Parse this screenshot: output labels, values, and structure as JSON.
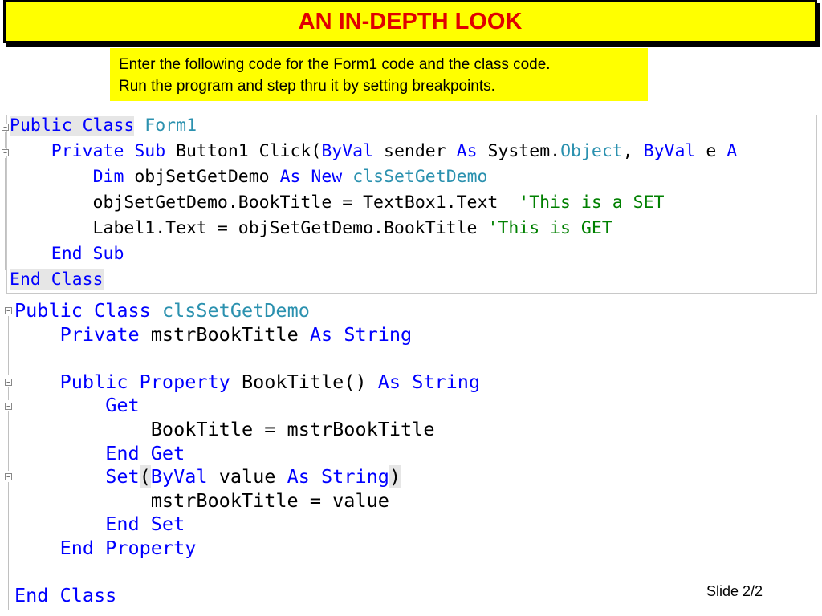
{
  "title": "AN IN-DEPTH LOOK",
  "instructions": [
    "Enter the following code for the Form1 code and the class code.",
    "Run the program and step thru it by setting breakpoints."
  ],
  "form1_code": [
    [
      [
        "Public Class",
        "kw hl"
      ],
      [
        " ",
        ""
      ],
      [
        "Form1",
        "ty"
      ]
    ],
    [
      [
        "    ",
        ""
      ],
      [
        "Private Sub",
        "kw"
      ],
      [
        " Button1_Click(",
        ""
      ],
      [
        "ByVal",
        "kw"
      ],
      [
        " sender ",
        ""
      ],
      [
        "As",
        "kw"
      ],
      [
        " System.",
        ""
      ],
      [
        "Object",
        "ty"
      ],
      [
        ", ",
        ""
      ],
      [
        "ByVal",
        "kw"
      ],
      [
        " e ",
        ""
      ],
      [
        "A",
        "kw"
      ]
    ],
    [
      [
        "        ",
        ""
      ],
      [
        "Dim",
        "kw"
      ],
      [
        " objSetGetDemo ",
        ""
      ],
      [
        "As New",
        "kw"
      ],
      [
        " ",
        ""
      ],
      [
        "clsSetGetDemo",
        "ty"
      ]
    ],
    [
      [
        "        objSetGetDemo.BookTitle = TextBox1.Text  ",
        ""
      ],
      [
        "'This is a SET",
        "cm"
      ]
    ],
    [
      [
        "        Label1.Text = objSetGetDemo.BookTitle ",
        ""
      ],
      [
        "'This is GET",
        "cm"
      ]
    ],
    [
      [
        "    ",
        ""
      ],
      [
        "End Sub",
        "kw"
      ]
    ],
    [
      [
        "End Class",
        "kw hl"
      ]
    ]
  ],
  "class_code": [
    [
      [
        "Public Class",
        "kw"
      ],
      [
        " ",
        ""
      ],
      [
        "clsSetGetDemo",
        "ty"
      ]
    ],
    [
      [
        "    ",
        ""
      ],
      [
        "Private",
        "kw"
      ],
      [
        " mstrBookTitle ",
        ""
      ],
      [
        "As String",
        "kw"
      ]
    ],
    [
      [
        "",
        ""
      ]
    ],
    [
      [
        "    ",
        ""
      ],
      [
        "Public Property",
        "kw"
      ],
      [
        " BookTitle() ",
        ""
      ],
      [
        "As String",
        "kw"
      ]
    ],
    [
      [
        "        ",
        ""
      ],
      [
        "Get",
        "kw"
      ]
    ],
    [
      [
        "            BookTitle = mstrBookTitle",
        ""
      ]
    ],
    [
      [
        "        ",
        ""
      ],
      [
        "End Get",
        "kw"
      ]
    ],
    [
      [
        "        ",
        ""
      ],
      [
        "Set",
        "kw"
      ],
      [
        "(",
        "hl"
      ],
      [
        "ByVal",
        "kw"
      ],
      [
        " value ",
        ""
      ],
      [
        "As String",
        "kw"
      ],
      [
        ")",
        "hl"
      ]
    ],
    [
      [
        "            mstrBookTitle = value",
        ""
      ]
    ],
    [
      [
        "        ",
        ""
      ],
      [
        "End Set",
        "kw"
      ]
    ],
    [
      [
        "    ",
        ""
      ],
      [
        "End Property",
        "kw"
      ]
    ],
    [
      [
        "",
        ""
      ]
    ],
    [
      [
        "End Class",
        "kw"
      ]
    ]
  ],
  "slide_number": "Slide 2/2",
  "colors": {
    "banner_bg": "#ffff00",
    "title_text": "#e00000",
    "keyword": "#0000ff",
    "type_name": "#2b91af",
    "comment": "#008000"
  }
}
